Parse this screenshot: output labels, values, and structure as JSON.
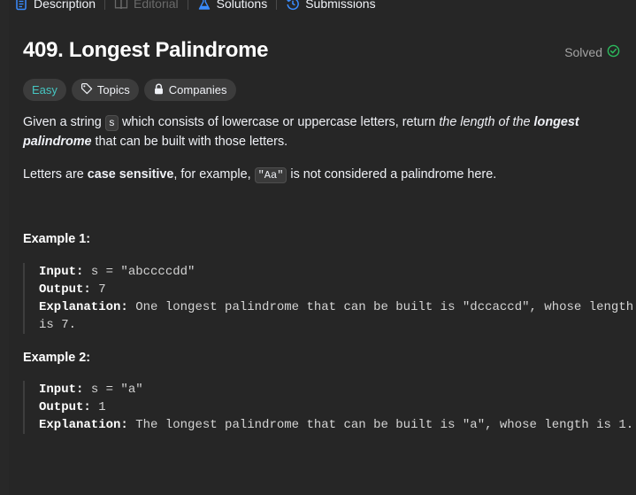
{
  "tabs": [
    {
      "label": "Description",
      "icon": "description-icon",
      "active": true
    },
    {
      "label": "Editorial",
      "icon": "book-icon",
      "active": false
    },
    {
      "label": "Solutions",
      "icon": "flask-icon",
      "active": true
    },
    {
      "label": "Submissions",
      "icon": "history-icon",
      "active": true
    }
  ],
  "problem": {
    "title": "409. Longest Palindrome",
    "status": "Solved",
    "difficulty": "Easy",
    "topics_label": "Topics",
    "companies_label": "Companies"
  },
  "description": {
    "p1_pre": "Given a string ",
    "p1_code": "s",
    "p1_mid": " which consists of lowercase or uppercase letters, return ",
    "p1_em1": "the length of the ",
    "p1_strong": "longest palindrome",
    "p1_post": " that can be built with those letters.",
    "p2_pre": "Letters are ",
    "p2_strong": "case sensitive",
    "p2_mid": ", for example, ",
    "p2_code": "\"Aa\"",
    "p2_post": " is not considered a palindrome here."
  },
  "examples": [
    {
      "title": "Example 1:",
      "input_label": "Input:",
      "input": " s = \"abccccdd\"",
      "output_label": "Output:",
      "output": " 7",
      "explanation_label": "Explanation:",
      "explanation": " One longest palindrome that can be built is \"dccaccd\", whose length is 7."
    },
    {
      "title": "Example 2:",
      "input_label": "Input:",
      "input": " s = \"a\"",
      "output_label": "Output:",
      "output": " 1",
      "explanation_label": "Explanation:",
      "explanation": " The longest palindrome that can be built is \"a\", whose length is 1."
    }
  ],
  "colors": {
    "background": "#262626",
    "easy": "#46c6c2",
    "solved_check": "#2cbb5d",
    "description_icon": "#3a8cff",
    "solutions_icon": "#3a8cff",
    "submissions_icon": "#3a8cff"
  }
}
